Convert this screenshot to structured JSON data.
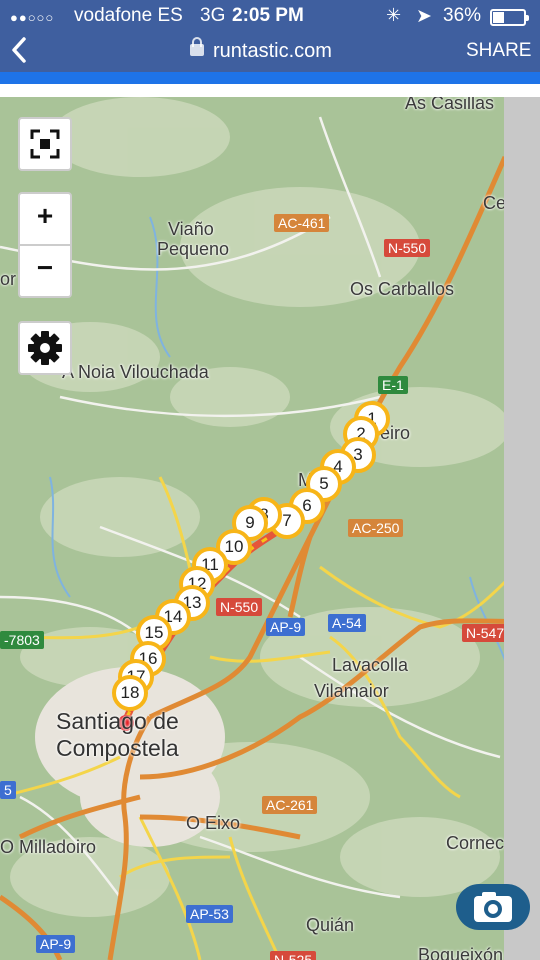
{
  "status": {
    "carrier": "vodafone ES",
    "network": "3G",
    "time": "2:05 PM",
    "battery": "36%",
    "battery_level": 0.36,
    "signal_dots": "●●○○○"
  },
  "browser": {
    "back_label": "<",
    "url": "runtastic.com",
    "share_label": "SHARE"
  },
  "map": {
    "places": [
      {
        "text": "As Casillas",
        "cls": ""
      },
      {
        "text": "Ce",
        "cls": ""
      },
      {
        "text": "Viaño",
        "cls": ""
      },
      {
        "text": "Pequeno",
        "cls": ""
      },
      {
        "text": "or",
        "cls": ""
      },
      {
        "text": "Os Carballos",
        "cls": ""
      },
      {
        "text": "A Noia Vilouchada",
        "cls": ""
      },
      {
        "text": "Ma",
        "cls": ""
      },
      {
        "text": "eiro",
        "cls": ""
      },
      {
        "text": "Lavacolla",
        "cls": ""
      },
      {
        "text": "Vilamaior",
        "cls": ""
      },
      {
        "text": "Santiago de",
        "cls": "big"
      },
      {
        "text": "Compostela",
        "cls": "big"
      },
      {
        "text": "O Eixo",
        "cls": ""
      },
      {
        "text": "O Milladoiro",
        "cls": ""
      },
      {
        "text": "Cornec",
        "cls": ""
      },
      {
        "text": "Quián",
        "cls": ""
      },
      {
        "text": "Boqueixón",
        "cls": ""
      }
    ],
    "roads": [
      {
        "text": "AC-461",
        "color": "orange"
      },
      {
        "text": "N-550",
        "color": "red"
      },
      {
        "text": "E-1",
        "color": "green"
      },
      {
        "text": "AC-250",
        "color": "orange"
      },
      {
        "text": "N-550",
        "color": "red"
      },
      {
        "text": "AP-9",
        "color": "blue"
      },
      {
        "text": "A-54",
        "color": "blue"
      },
      {
        "text": "N-547",
        "color": "red"
      },
      {
        "text": "-7803",
        "color": "green"
      },
      {
        "text": "AC-261",
        "color": "orange"
      },
      {
        "text": "AP-53",
        "color": "blue"
      },
      {
        "text": "AP-9",
        "color": "blue"
      },
      {
        "text": "N-525",
        "color": "red"
      },
      {
        "text": "5",
        "color": "blue"
      }
    ],
    "zoom_in_label": "+",
    "zoom_out_label": "−",
    "markers": [
      "1",
      "2",
      "3",
      "4",
      "5",
      "6",
      "7",
      "8",
      "9",
      "10",
      "11",
      "12",
      "13",
      "14",
      "15",
      "16",
      "17",
      "18"
    ]
  },
  "icons": {
    "fullscreen": "fullscreen-icon",
    "settings": "gear-icon",
    "photo": "camera-icon",
    "lock": "lock-icon",
    "back": "chevron-left-icon"
  },
  "colors": {
    "header": "#3f5f9f",
    "progress": "#1e73e8",
    "marker_border": "#f7b518",
    "route": "#e5563a",
    "end_point": "#e3141b"
  }
}
